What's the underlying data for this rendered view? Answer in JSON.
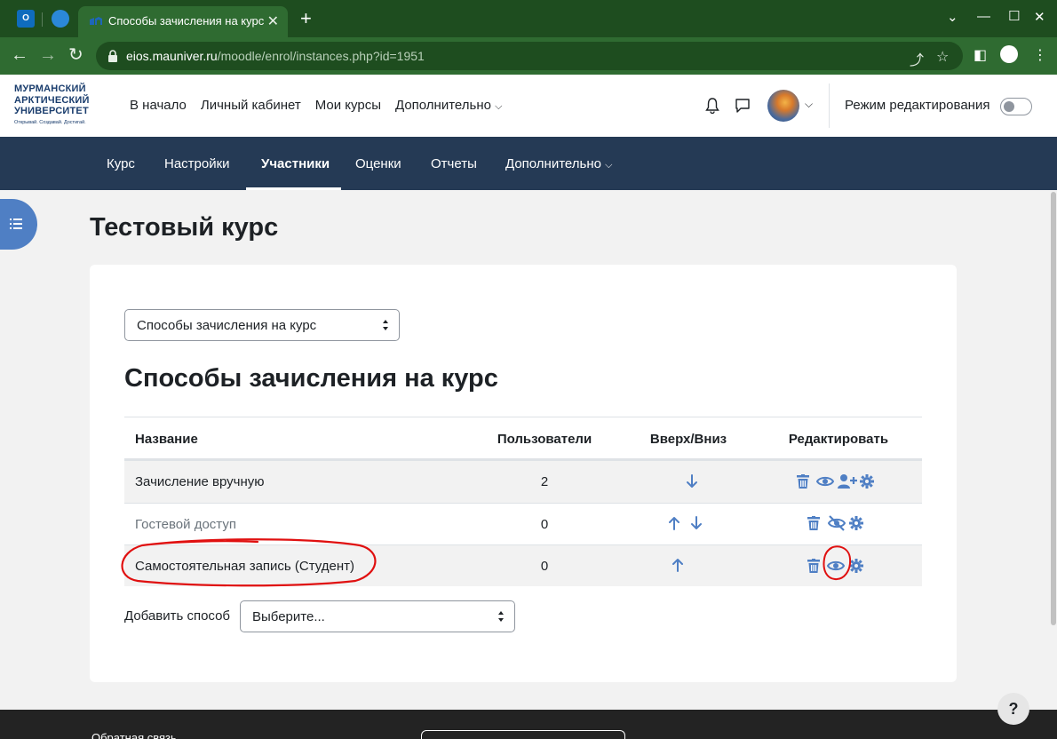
{
  "browser": {
    "tab_title": "Способы зачисления на курс",
    "pinned_tab_1": "O",
    "url_host": "eios.mauniver.ru",
    "url_path": "/moodle/enrol/instances.php?id=1951"
  },
  "logo": {
    "line1": "МУРМАНСКИЙ",
    "line2": "АРКТИЧЕСКИЙ",
    "line3": "УНИВЕРСИТЕТ",
    "tagline": "Открывай. Создавай. Достигай."
  },
  "topnav": {
    "home": "В начало",
    "dashboard": "Личный кабинет",
    "my_courses": "Мои курсы",
    "more": "Дополнительно"
  },
  "header": {
    "edit_mode_label": "Режим редактирования"
  },
  "secondary_nav": {
    "course": "Курс",
    "settings": "Настройки",
    "participants": "Участники",
    "grades": "Оценки",
    "reports": "Отчеты",
    "more": "Дополнительно"
  },
  "page": {
    "course_title": "Тестовый курс",
    "selector_value": "Способы зачисления на курс",
    "section_title": "Способы зачисления на курс",
    "add_method_label": "Добавить способ",
    "add_method_value": "Выберите..."
  },
  "table": {
    "headers": {
      "name": "Название",
      "users": "Пользователи",
      "updown": "Вверх/Вниз",
      "edit": "Редактировать"
    },
    "rows": [
      {
        "name": "Зачисление вручную",
        "users": "2"
      },
      {
        "name": "Гостевой доступ",
        "users": "0"
      },
      {
        "name": "Самостоятельная запись (Студент)",
        "users": "0"
      }
    ]
  },
  "footer": {
    "feedback": "Обратная связь"
  },
  "help": {
    "label": "?"
  },
  "colors": {
    "accent": "#0f6cbd",
    "icon_blue": "#4f7fc4",
    "nav_bg": "#253a55",
    "chrome_green": "#2f6b31",
    "annotation_red": "#e01010"
  }
}
